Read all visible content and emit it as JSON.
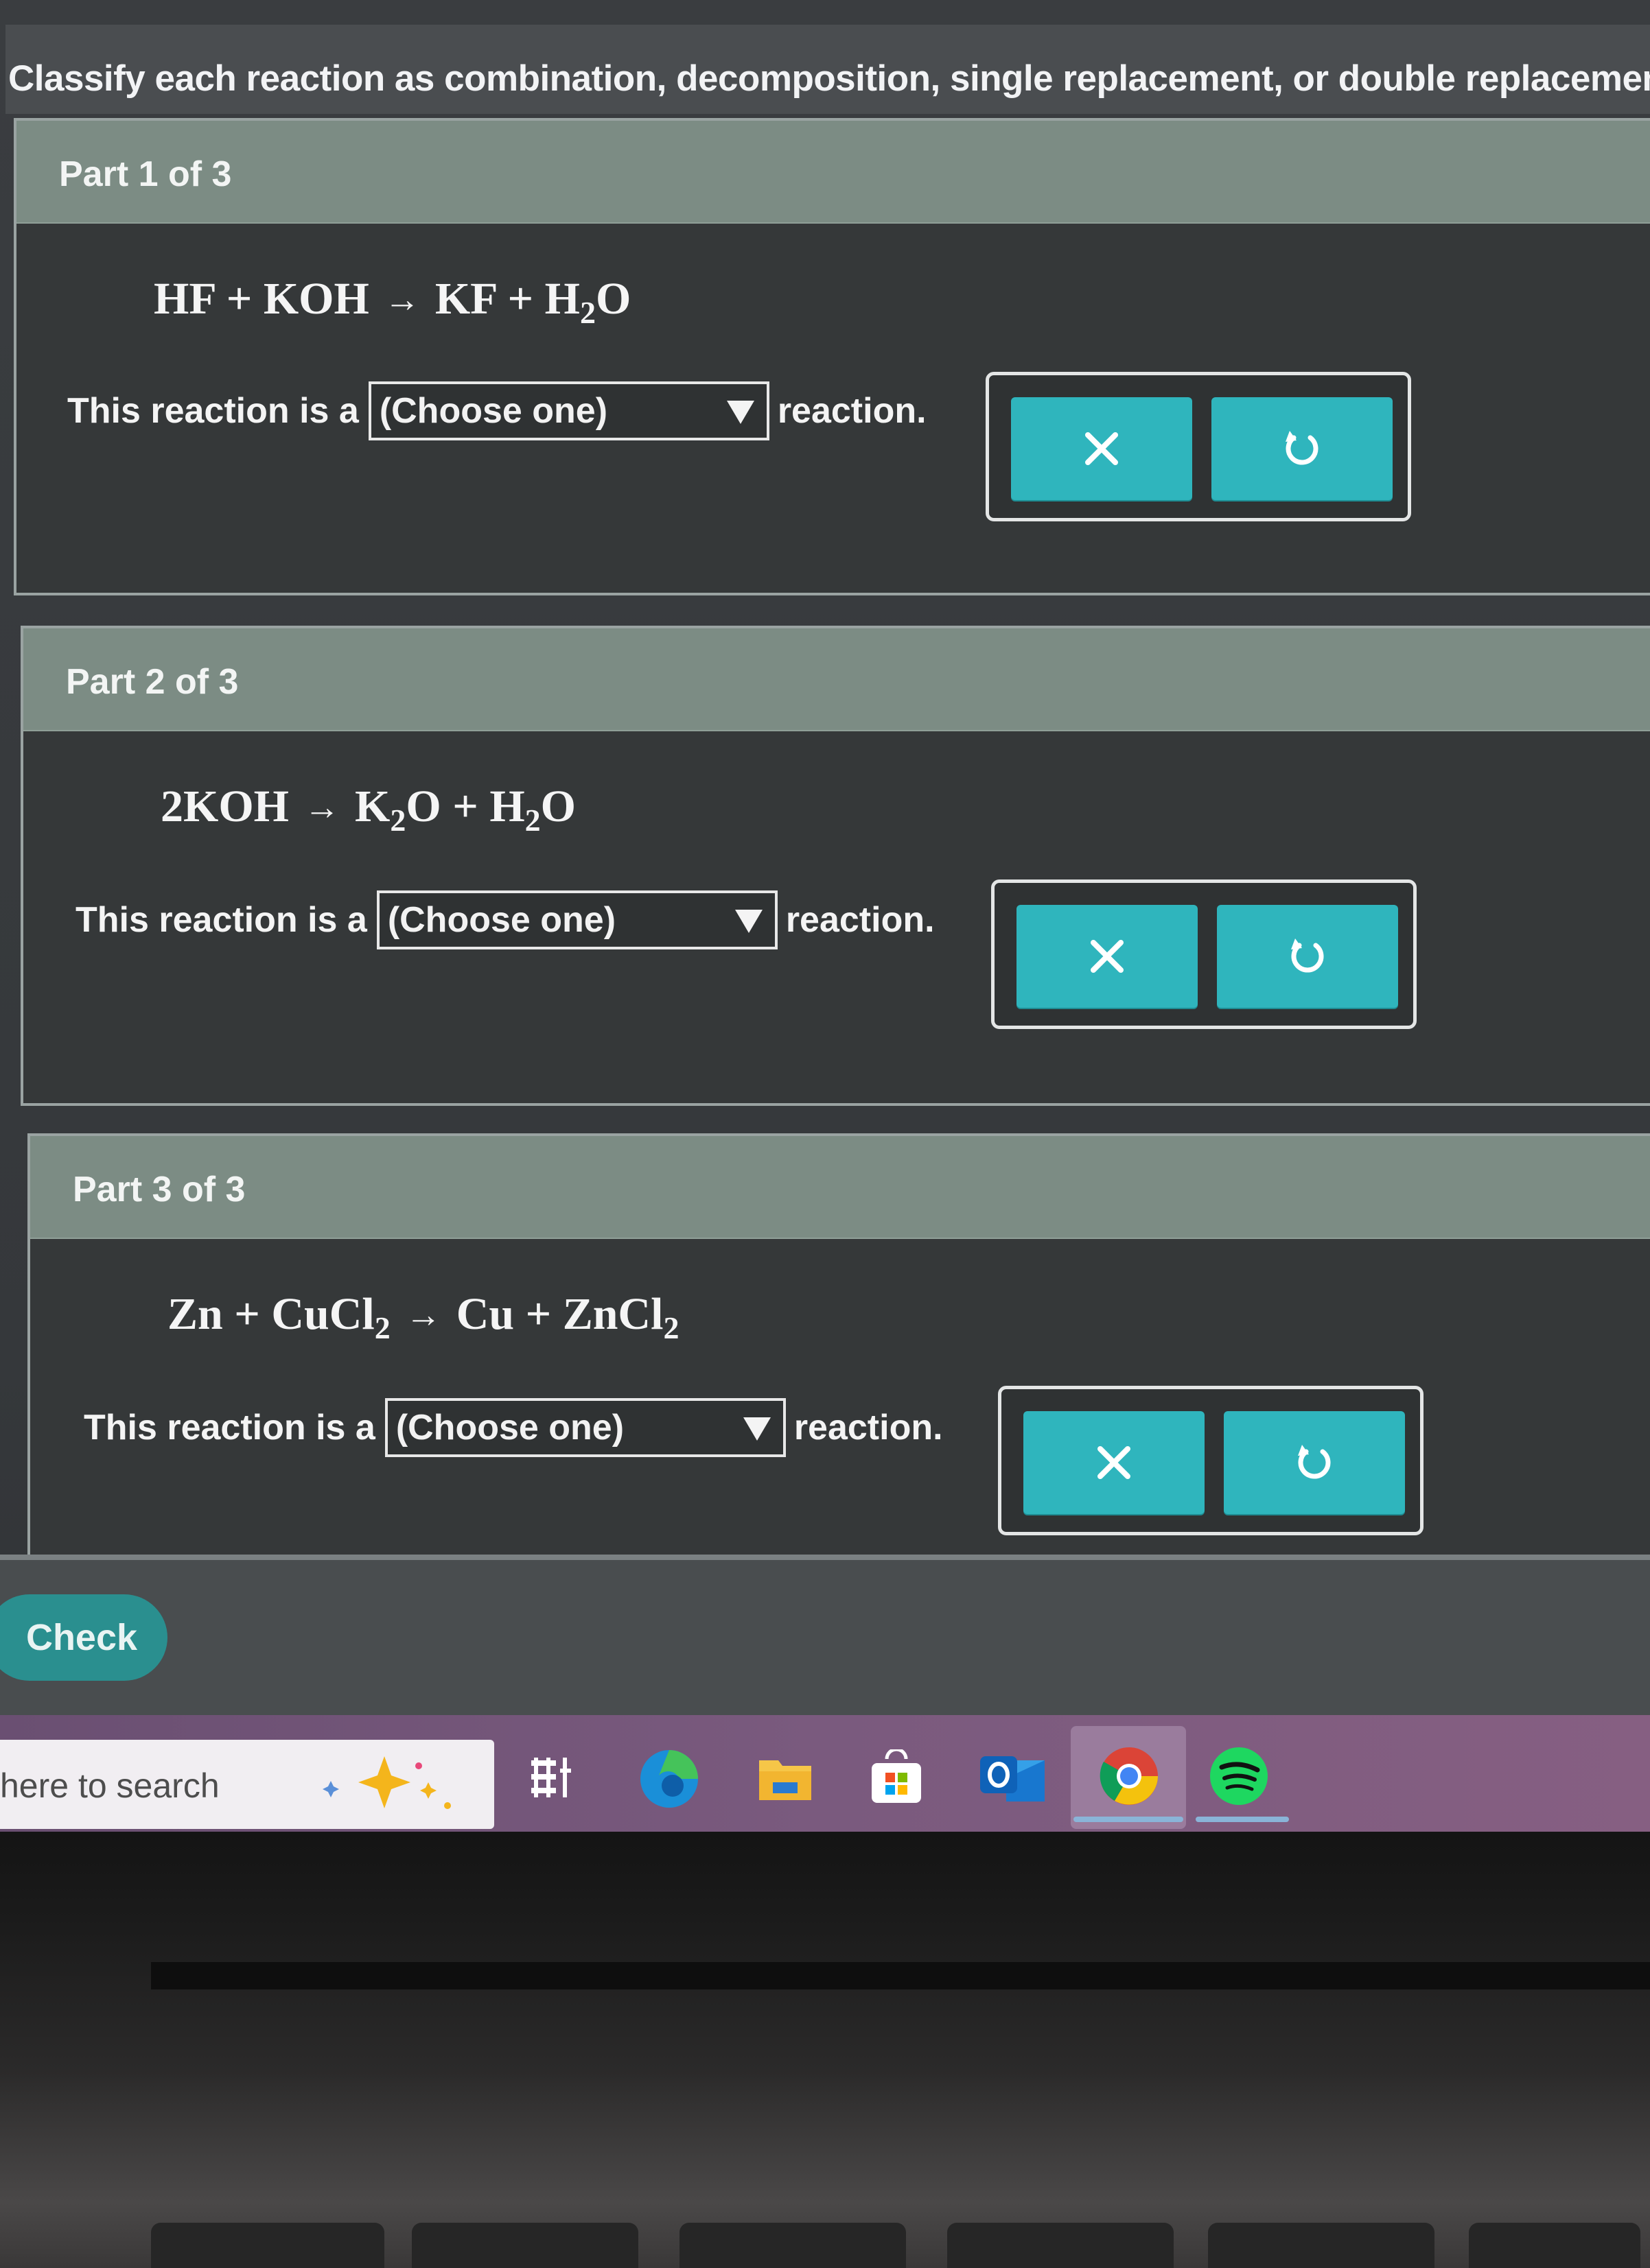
{
  "question": {
    "text": "Classify each reaction as combination, decomposition, single replacement, or double replacement."
  },
  "parts": [
    {
      "title": "Part 1 of 3",
      "equation": {
        "reactants": [
          [
            "HF"
          ],
          [
            "KOH"
          ]
        ],
        "products": [
          [
            "KF"
          ],
          [
            "H",
            "2",
            "O"
          ]
        ]
      },
      "prompt_before": "This reaction is a",
      "select_value": "(Choose one)",
      "prompt_after": "reaction."
    },
    {
      "title": "Part 2 of 3",
      "equation": {
        "reactants": [
          [
            "2KOH"
          ]
        ],
        "products": [
          [
            "K",
            "2",
            "O"
          ],
          [
            "H",
            "2",
            "O"
          ]
        ]
      },
      "prompt_before": "This reaction is a",
      "select_value": "(Choose one)",
      "prompt_after": "reaction."
    },
    {
      "title": "Part 3 of 3",
      "equation": {
        "reactants": [
          [
            "Zn"
          ],
          [
            "CuCl",
            "2"
          ]
        ],
        "products": [
          [
            "Cu"
          ],
          [
            "ZnCl",
            "2"
          ]
        ]
      },
      "prompt_before": "This reaction is a",
      "select_value": "(Choose one)",
      "prompt_after": "reaction."
    }
  ],
  "check_button": "Check",
  "taskbar": {
    "search_text": "here to search",
    "icons": [
      "task-view-icon",
      "edge-icon",
      "file-explorer-icon",
      "microsoft-store-icon",
      "outlook-icon",
      "chrome-icon",
      "spotify-icon"
    ]
  },
  "colors": {
    "accent_teal": "#2fb5bd",
    "header_green": "#7c8c84",
    "check_teal": "#2a8f8f"
  }
}
